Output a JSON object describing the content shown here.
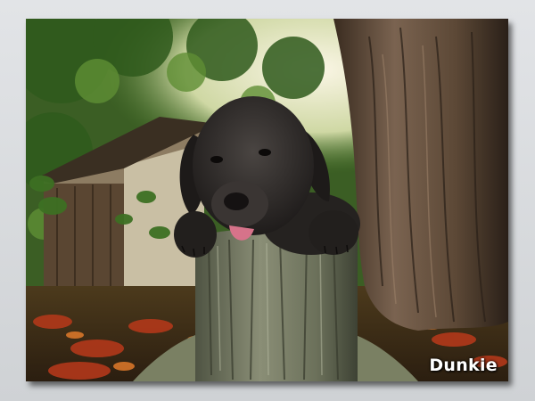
{
  "caption": "Dunkie",
  "scene": {
    "subject-icon": "puppy-icon",
    "colors": {
      "border": "#d7d9dc",
      "foliage": "#3f6b25",
      "puppy": "#2a2725",
      "bark": "#5a4a3a",
      "stump": "#6b6f5a",
      "leaves_ground": "#a8361a"
    }
  }
}
